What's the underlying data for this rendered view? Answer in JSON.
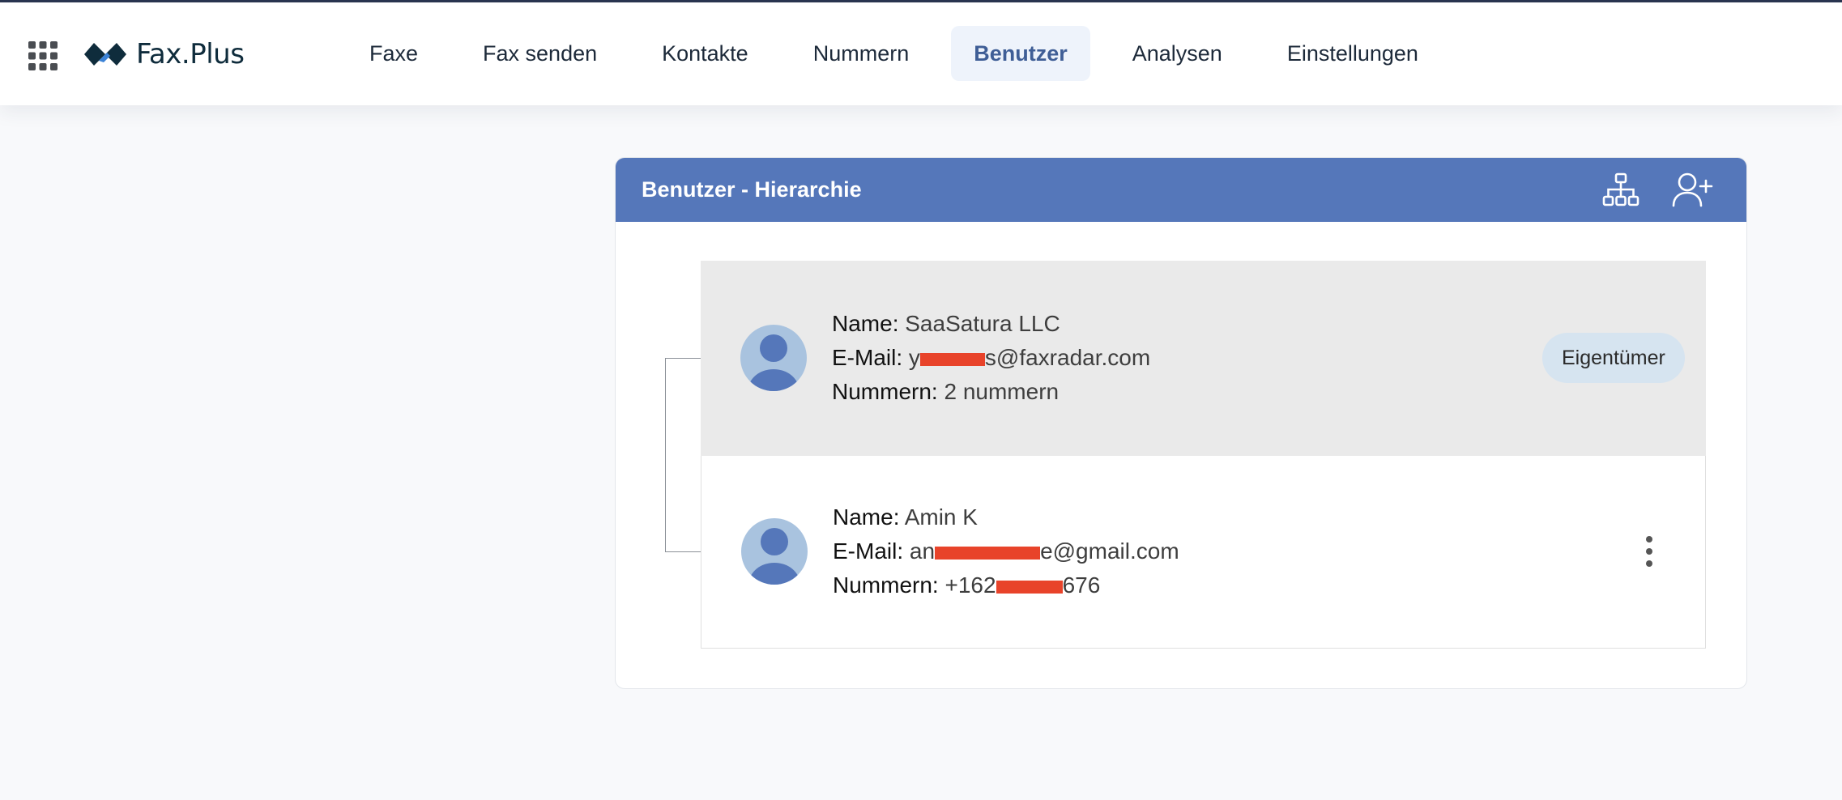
{
  "header": {
    "logo_text": "Fax.Plus",
    "nav": [
      {
        "label": "Faxe"
      },
      {
        "label": "Fax senden"
      },
      {
        "label": "Kontakte"
      },
      {
        "label": "Nummern"
      },
      {
        "label": "Benutzer",
        "active": true
      },
      {
        "label": "Analysen"
      },
      {
        "label": "Einstellungen"
      }
    ]
  },
  "card": {
    "title": "Benutzer - Hierarchie",
    "icons": [
      "hierarchy-icon",
      "add-user-icon"
    ]
  },
  "labels": {
    "name": "Name:",
    "email": "E-Mail:",
    "numbers": "Nummern:"
  },
  "users": [
    {
      "name": "SaaSatura LLC",
      "email_start": "y",
      "email_end": "s@faxradar.com",
      "numbers_start": "2 nummern",
      "numbers_end": "",
      "badge": "Eigentümer"
    },
    {
      "name": "Amin K",
      "email_start": "an",
      "email_end": "e@gmail.com",
      "numbers_start": "+162",
      "numbers_end": "676"
    }
  ],
  "colors": {
    "card_header": "#5577ba",
    "active_nav_bg": "#eef3fb",
    "active_nav_text": "#3f5e96",
    "owner_row_bg": "#eaeaea",
    "badge_bg": "#d6e4f0",
    "redaction": "#e8432a"
  }
}
